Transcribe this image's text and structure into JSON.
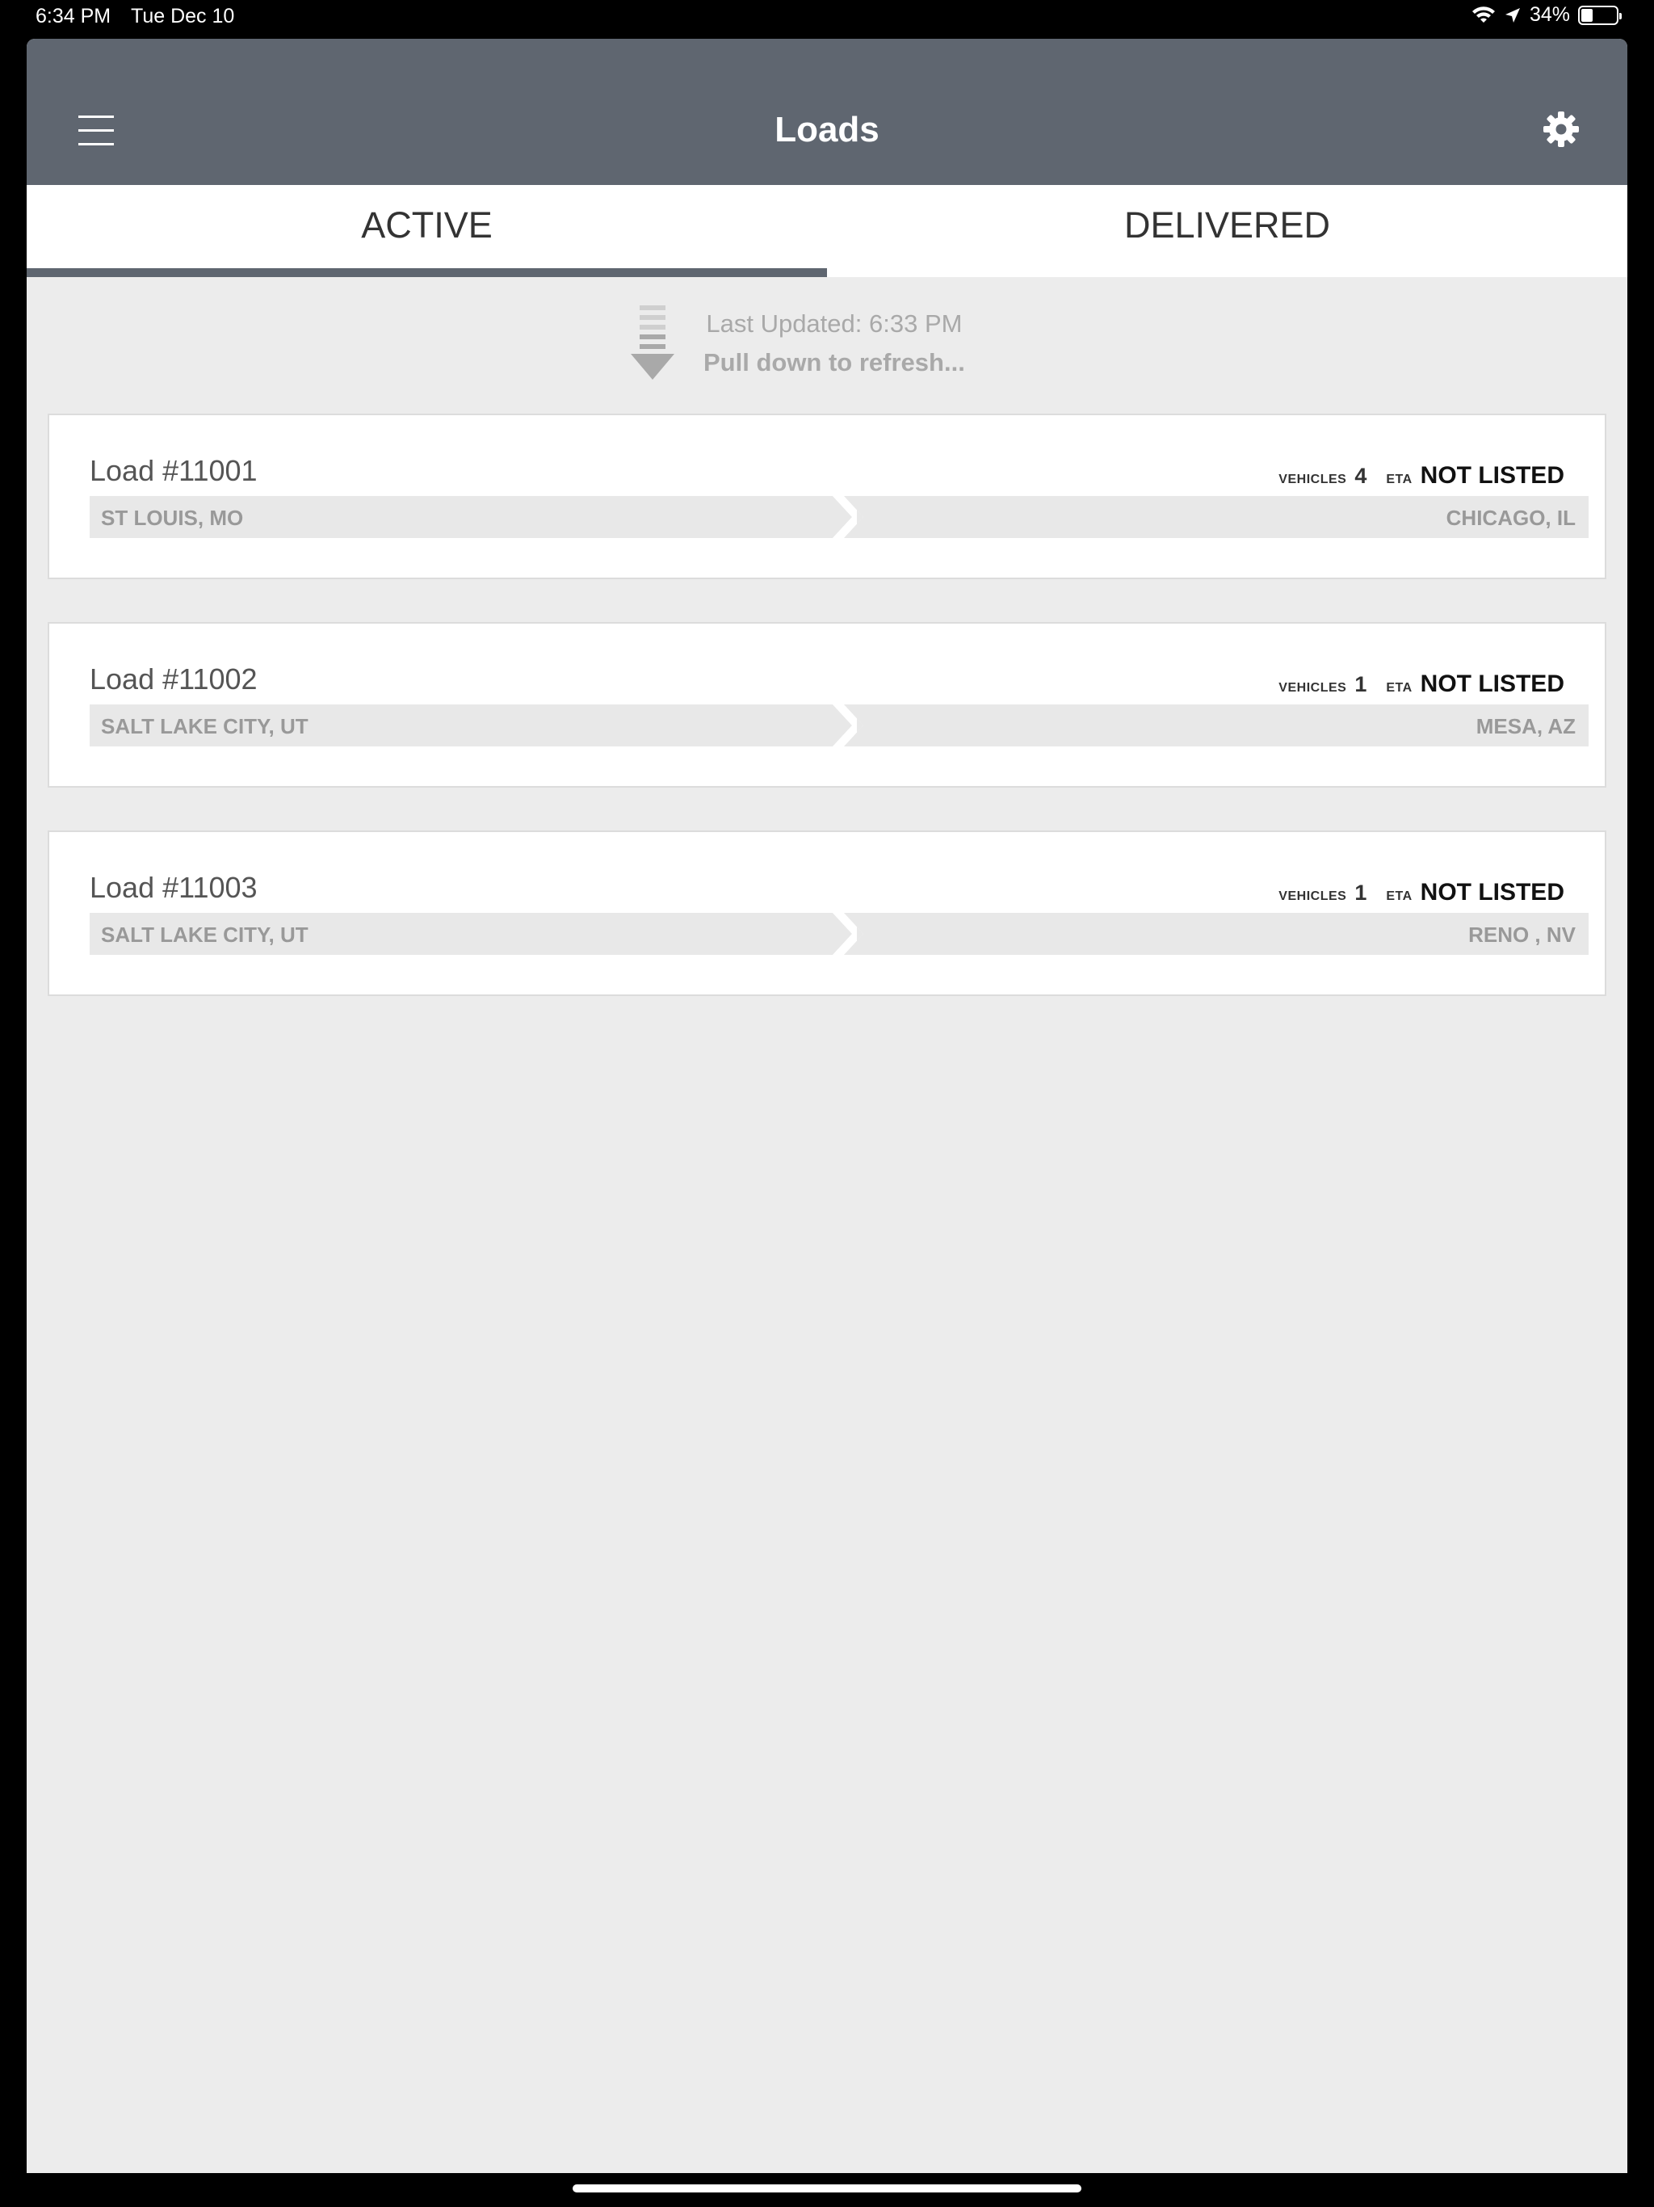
{
  "status_bar": {
    "time": "6:34 PM",
    "date": "Tue Dec 10",
    "battery": "34%"
  },
  "header": {
    "title": "Loads",
    "menu_icon": "hamburger-menu-icon",
    "settings_icon": "gear-icon",
    "background_color": "#5f6670"
  },
  "tabs": [
    {
      "label": "ACTIVE",
      "selected": true
    },
    {
      "label": "DELIVERED",
      "selected": false
    }
  ],
  "refresh": {
    "last_updated": "Last Updated: 6:33 PM",
    "hint": "Pull down to refresh..."
  },
  "loads": [
    {
      "title": "Load #11001",
      "vehicles_label": "VEHICLES",
      "vehicles_count": "4",
      "eta_label": "ETA",
      "eta_value": "NOT LISTED",
      "origin": "ST LOUIS, MO",
      "destination": "CHICAGO, IL"
    },
    {
      "title": "Load #11002",
      "vehicles_label": "VEHICLES",
      "vehicles_count": "1",
      "eta_label": "ETA",
      "eta_value": "NOT LISTED",
      "origin": "SALT LAKE CITY, UT",
      "destination": "MESA, AZ"
    },
    {
      "title": "Load #11003",
      "vehicles_label": "VEHICLES",
      "vehicles_count": "1",
      "eta_label": "ETA",
      "eta_value": "NOT LISTED",
      "origin": "SALT LAKE CITY, UT",
      "destination": "RENO , NV"
    }
  ]
}
